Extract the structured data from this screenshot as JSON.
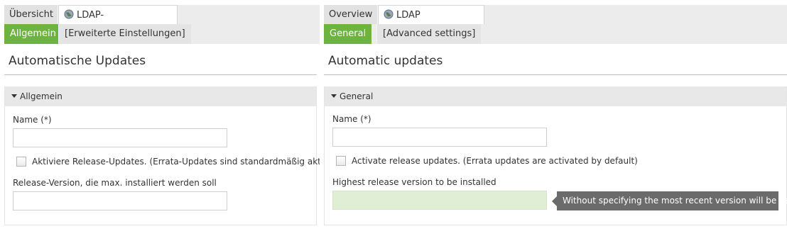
{
  "left": {
    "tabs": [
      {
        "label": "Übersicht"
      },
      {
        "label": "LDAP-Verzeichnis",
        "close": "×"
      }
    ],
    "subtabs": [
      {
        "label": "Allgemein"
      },
      {
        "label": "[Erweiterte Einstellungen]"
      }
    ],
    "page_title": "Automatische Updates",
    "section_title": "Allgemein",
    "name_label": "Name (*)",
    "name_value": "",
    "checkbox_label": "Aktiviere Release-Updates. (Errata-Updates sind standardmäßig aktiviert)",
    "release_label": "Release-Version, die max. installiert werden soll",
    "release_value": ""
  },
  "right": {
    "tabs": [
      {
        "label": "Overview"
      },
      {
        "label": "LDAP directory",
        "close": "×"
      }
    ],
    "subtabs": [
      {
        "label": "General"
      },
      {
        "label": "[Advanced settings]"
      }
    ],
    "page_title": "Automatic updates",
    "section_title": "General",
    "name_label": "Name (*)",
    "name_value": "",
    "checkbox_label": "Activate release updates. (Errata updates are activated by default)",
    "release_label": "Highest release version to be installed",
    "release_value": "",
    "tooltip": "Without specifying the most recent version will be used"
  },
  "colors": {
    "accent": "#6db33f",
    "focused_input": "#e1eed6",
    "tooltip_bg": "#6b6b6b"
  },
  "icons": {
    "tab_icon": "globe-icon",
    "close_icon": "close-icon",
    "section_toggle": "triangle-down-icon"
  }
}
